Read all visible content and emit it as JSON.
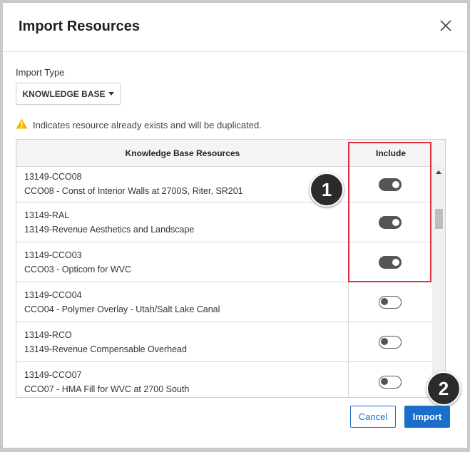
{
  "dialog": {
    "title": "Import Resources",
    "import_type_label": "Import Type",
    "import_type_value": "KNOWLEDGE BASE",
    "warning_text": "Indicates resource already exists and will be duplicated."
  },
  "table": {
    "col_resources": "Knowledge Base Resources",
    "col_include": "Include",
    "rows": [
      {
        "id": "13149-CCO08",
        "name": "CCO08 - Const of Interior Walls at 2700S, Riter, SR201",
        "include": true
      },
      {
        "id": "13149-RAL",
        "name": "13149-Revenue Aesthetics and Landscape",
        "include": true
      },
      {
        "id": "13149-CCO03",
        "name": "CCO03 - Opticom for WVC",
        "include": true
      },
      {
        "id": "13149-CCO04",
        "name": "CCO04 - Polymer Overlay - Utah/Salt Lake Canal",
        "include": false
      },
      {
        "id": "13149-RCO",
        "name": "13149-Revenue Compensable Overhead",
        "include": false
      },
      {
        "id": "13149-CCO07",
        "name": "CCO07 - HMA Fill for WVC at 2700 South",
        "include": false
      }
    ]
  },
  "annotations": {
    "badge_1": "1",
    "badge_2": "2"
  },
  "footer": {
    "cancel_label": "Cancel",
    "import_label": "Import"
  },
  "colors": {
    "accent": "#1a6fc9",
    "highlight": "#e0303a",
    "warning": "#f5b800"
  },
  "icons": [
    "close-icon",
    "caret-down-icon",
    "warning-icon",
    "scroll-up-icon"
  ]
}
